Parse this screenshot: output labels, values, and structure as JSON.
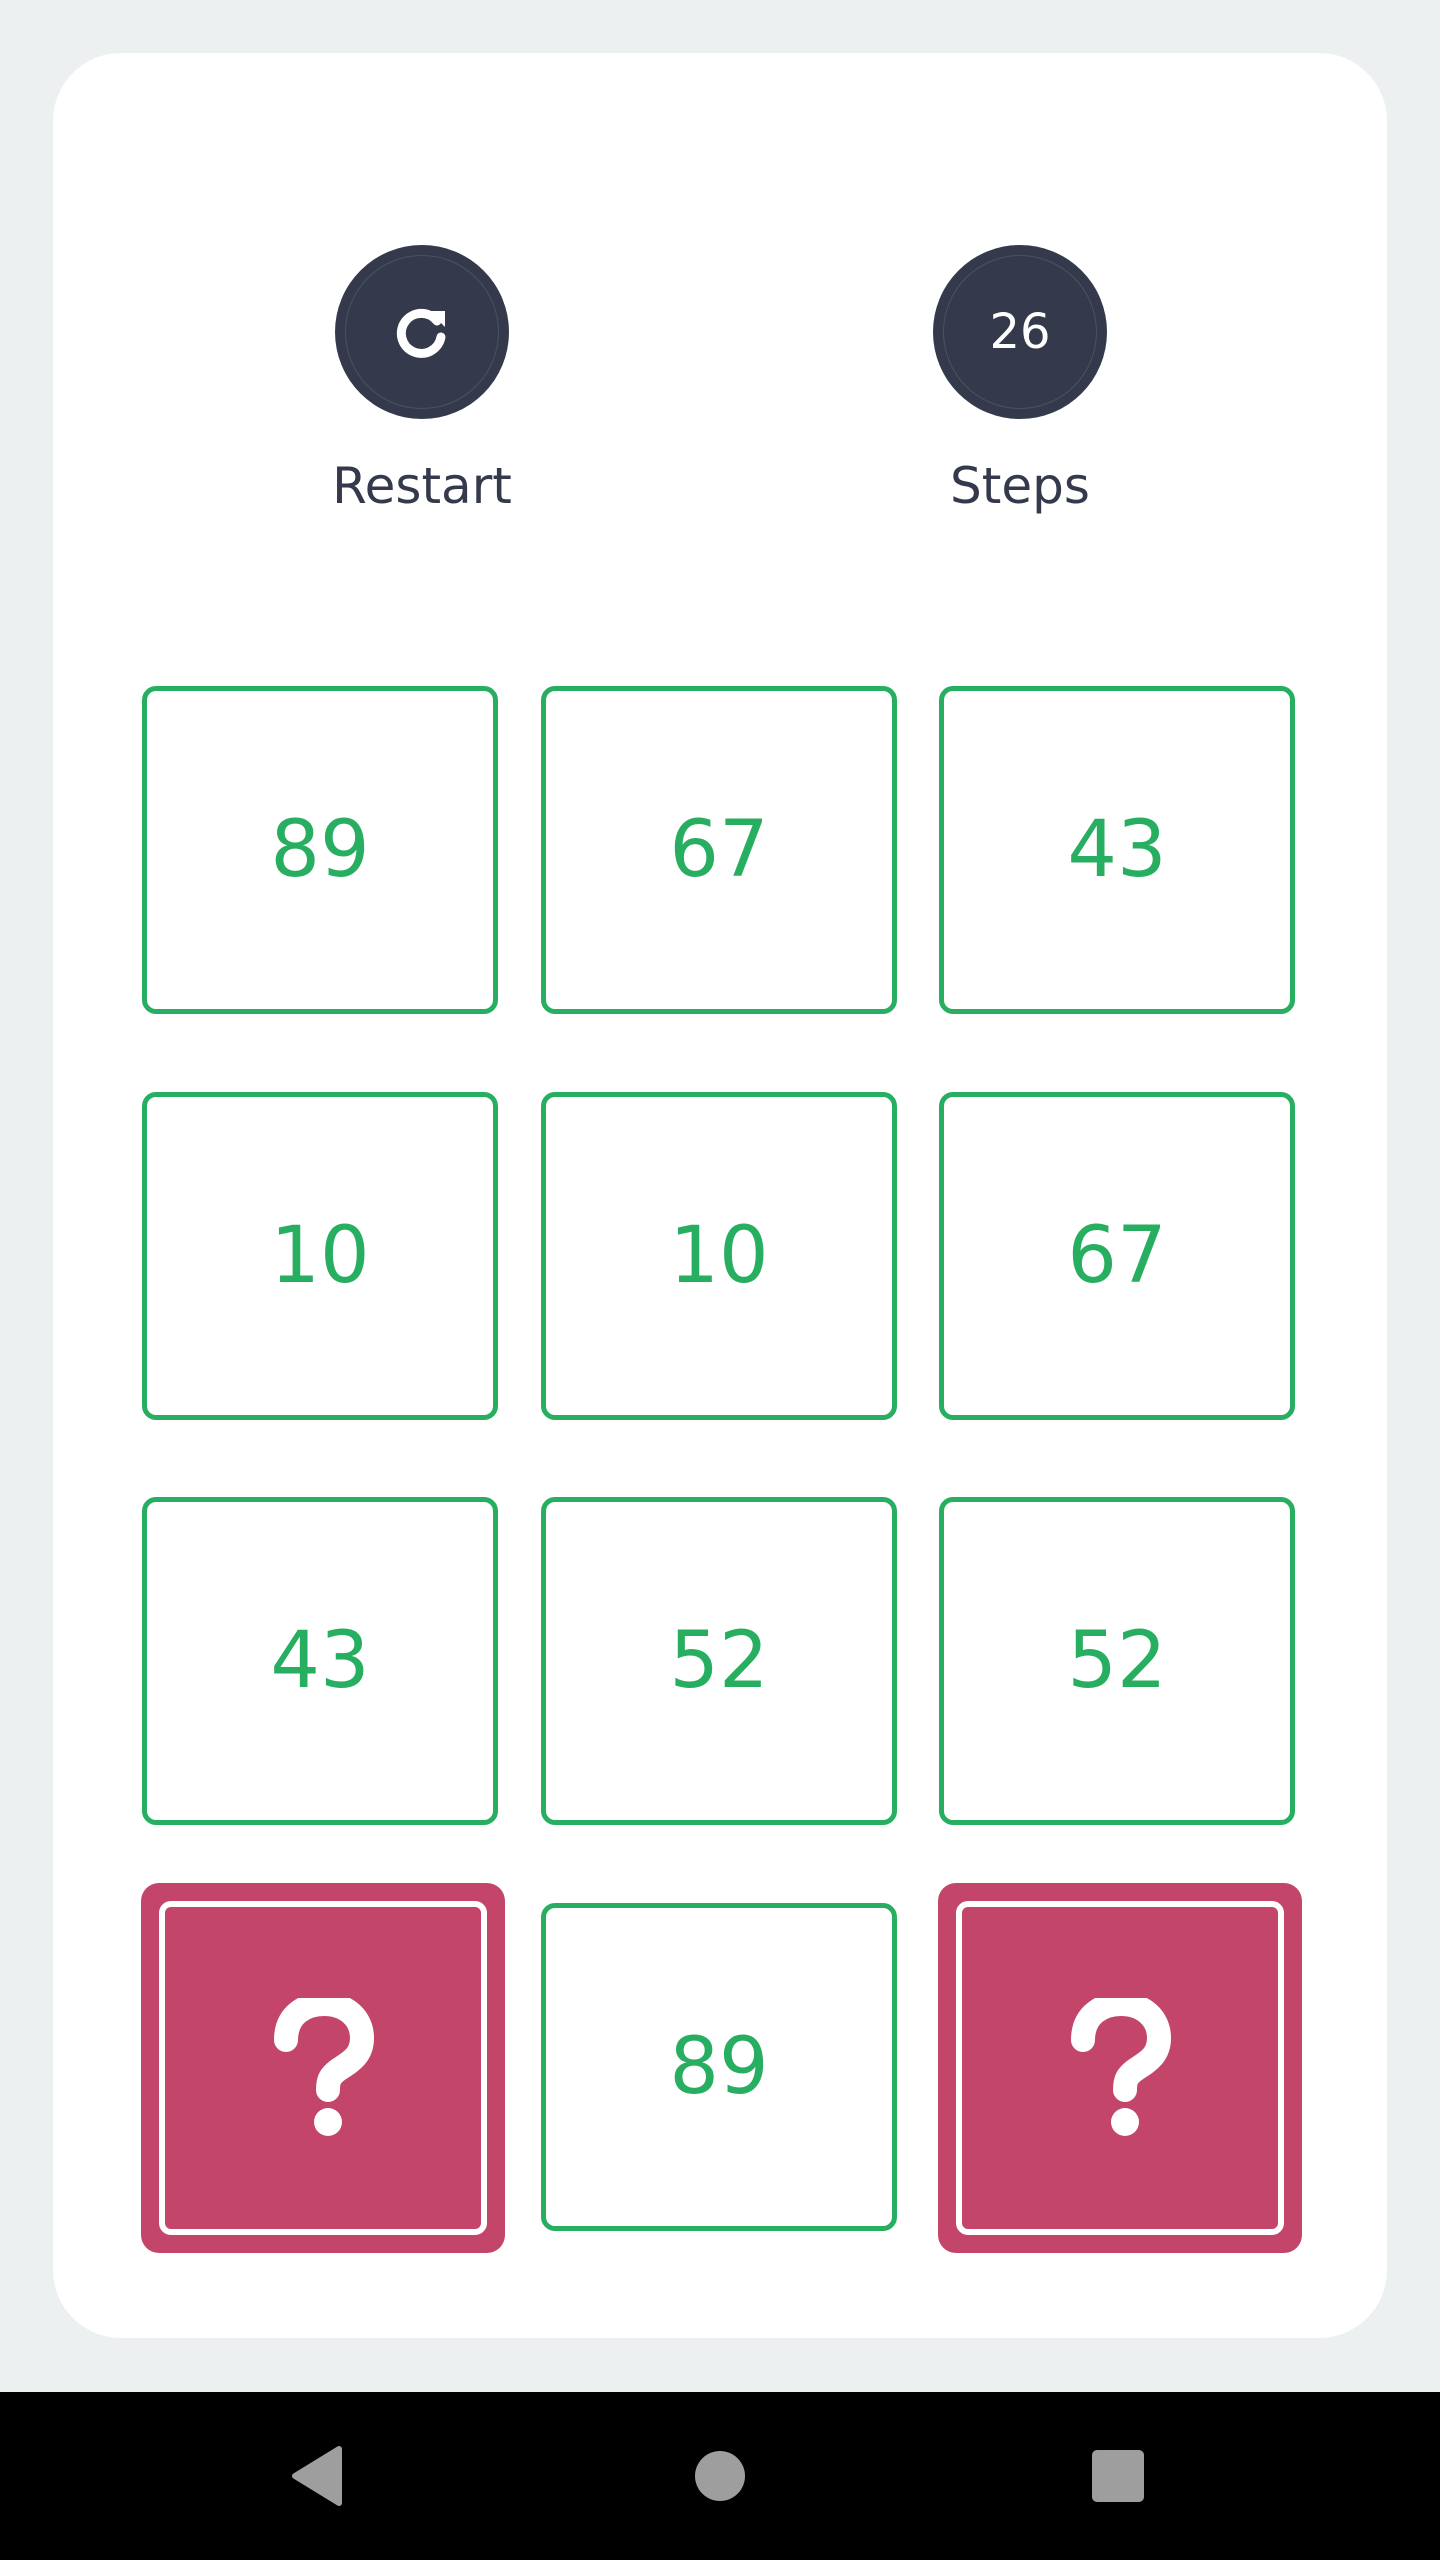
{
  "controls": {
    "restart_label": "Restart",
    "steps_label": "Steps",
    "steps_count": "26"
  },
  "tiles": [
    {
      "value": "89",
      "state": "revealed"
    },
    {
      "value": "67",
      "state": "revealed"
    },
    {
      "value": "43",
      "state": "revealed"
    },
    {
      "value": "10",
      "state": "revealed"
    },
    {
      "value": "10",
      "state": "revealed"
    },
    {
      "value": "67",
      "state": "revealed"
    },
    {
      "value": "43",
      "state": "revealed"
    },
    {
      "value": "52",
      "state": "revealed"
    },
    {
      "value": "52",
      "state": "revealed"
    },
    {
      "value": "",
      "state": "hidden",
      "icon": "question-icon"
    },
    {
      "value": "89",
      "state": "revealed"
    },
    {
      "value": "",
      "state": "hidden",
      "icon": "question-icon"
    }
  ],
  "colors": {
    "background": "#ecf0f1",
    "card": "#ffffff",
    "control_circle": "#343a4b",
    "tile_green": "#27ae60",
    "tile_hidden": "#c4456a"
  },
  "navbar": {
    "icons": [
      "back-icon",
      "home-icon",
      "recents-icon"
    ]
  }
}
